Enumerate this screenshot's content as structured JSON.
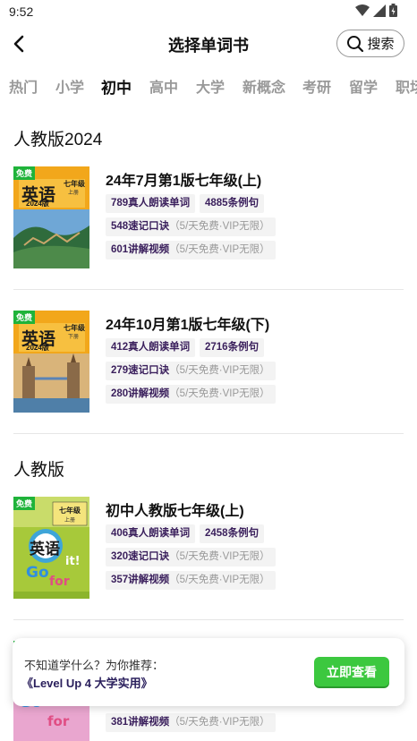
{
  "status": {
    "time": "9:52"
  },
  "header": {
    "title": "选择单词书",
    "search_label": "搜索"
  },
  "tabs": [
    "热门",
    "小学",
    "初中",
    "高中",
    "大学",
    "新概念",
    "考研",
    "留学",
    "职场"
  ],
  "active_tab": "初中",
  "sections": [
    {
      "title": "人教版2024",
      "books": [
        {
          "free": "免费",
          "cover_title": "英语",
          "cover_grade": "七年级",
          "cover_vol": "上册",
          "cover_year": "2024版",
          "title": "24年7月第1版七年级(上)",
          "words": "789真人朗读单词",
          "sentences": "4885条例句",
          "mnemonic": "548速记口诀",
          "videos": "601讲解视频",
          "quota": "（5/天免费·VIP无限）"
        },
        {
          "free": "免费",
          "cover_title": "英语",
          "cover_grade": "七年级",
          "cover_vol": "下册",
          "cover_year": "2024版",
          "title": "24年10月第1版七年级(下)",
          "words": "412真人朗读单词",
          "sentences": "2716条例句",
          "mnemonic": "279速记口诀",
          "videos": "280讲解视频",
          "quota": "（5/天免费·VIP无限）"
        }
      ]
    },
    {
      "title": "人教版",
      "books": [
        {
          "free": "免费",
          "cover_title": "英语",
          "cover_grade": "七年级",
          "cover_vol": "上册",
          "title": "初中人教版七年级(上)",
          "words": "406真人朗读单词",
          "sentences": "2458条例句",
          "mnemonic": "320速记口诀",
          "videos": "357讲解视频",
          "quota": "（5/天免费·VIP无限）"
        },
        {
          "videos": "381讲解视频",
          "quota": "（5/天免费·VIP无限）"
        }
      ]
    }
  ],
  "recommend": {
    "hint": "不知道学什么？为你推荐：",
    "book": "《Level Up 4 大学实用》",
    "button": "立即查看"
  },
  "colors": {
    "accent_green": "#3cc83f",
    "badge_green": "#1fb33a",
    "tag_text": "#3a1f5c"
  }
}
